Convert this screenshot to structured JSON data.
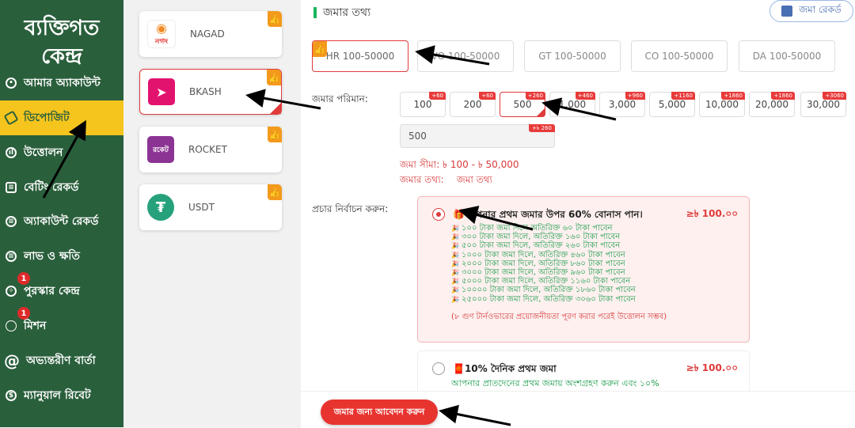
{
  "sidebar": {
    "title_line1": "ব্যক্তিগত",
    "title_line2": "কেন্দ্র",
    "items": [
      {
        "label": "আমার অ্যাকাউন্ট",
        "icon": "account-icon"
      },
      {
        "label": "ডিপোজিট",
        "icon": "deposit-icon",
        "active": true
      },
      {
        "label": "উত্তোলন",
        "icon": "withdraw-icon"
      },
      {
        "label": "বেটিং রেকর্ড",
        "icon": "betting-record-icon"
      },
      {
        "label": "অ্যাকাউন্ট রেকর্ড",
        "icon": "account-record-icon"
      },
      {
        "label": "লাভ ও ক্ষতি",
        "icon": "profit-loss-icon"
      },
      {
        "label": "পুরস্কার কেন্দ্র",
        "icon": "reward-icon",
        "badge": "1"
      },
      {
        "label": "মিশন",
        "icon": "mission-icon",
        "badge": "1"
      },
      {
        "label": "অভ্যন্তরীণ বার্তা",
        "icon": "at-icon"
      },
      {
        "label": "ম্যানুয়াল রিবেট",
        "icon": "rebate-icon"
      }
    ]
  },
  "payments": [
    {
      "name": "NAGAD",
      "logo_text": "নগদ",
      "color": "#ffffff"
    },
    {
      "name": "BKASH",
      "logo_text": "",
      "color": "#e2136e",
      "selected": true
    },
    {
      "name": "ROCKET",
      "logo_text": "রকেট",
      "color": "#8c3494"
    },
    {
      "name": "USDT",
      "logo_text": "₮",
      "color": "#26a17b"
    }
  ],
  "main": {
    "section_title": "জমার তথ্য",
    "record_button": "জমা রেকর্ড",
    "channels": [
      "HR 100-50000",
      "VO 100-50000",
      "GT 100-50000",
      "CO 100-50000",
      "DA 100-50000"
    ],
    "amount_label": "জমার পরিমান:",
    "amounts": [
      {
        "value": "100",
        "bonus": "+60"
      },
      {
        "value": "200",
        "bonus": "+60"
      },
      {
        "value": "500",
        "bonus": "+260",
        "selected": true
      },
      {
        "value": "1,000",
        "bonus": "+460"
      },
      {
        "value": "3,000",
        "bonus": "+960"
      },
      {
        "value": "5,000",
        "bonus": "+1160"
      },
      {
        "value": "10,000",
        "bonus": "+1860"
      },
      {
        "value": "20,000",
        "bonus": "+1860"
      },
      {
        "value": "30,000",
        "bonus": "+3060"
      }
    ],
    "amount_input_value": "500",
    "amount_input_bonus": "+৳ 260",
    "limit_text": "জমা সীমা:  ৳ 100 - ৳ 50,000",
    "info_label": "জমার তথ্য:",
    "info_value": "জমা তথ্য",
    "promo_label": "প্রচার নির্বাচন করুন:",
    "promo1": {
      "title": "🎁আপনার প্রথম জমার উপর 60% বোনাস পান।",
      "amount": "≥৳  100.০০",
      "lines": [
        "১০০ টাকা জমা দিলে অতিরিক্ত ৬০ টাকা পাবেন",
        "৩০০ টাকা জমা দিলে, অতিরিক্ত ১৬০ টাকা পাবেন",
        "৫০০ টাকা জমা দিলে, অতিরিক্ত ২৬০ টাকা পাবেন",
        "১০০০ টাকা জমা দিলে, অতিরিক্ত ৪৬০ টাকা পাবেন",
        "২০০০ টাকা জমা দিলে, অতিরিক্ত ৮৬০ টাকা পাবেন",
        "৩০০০ টাকা জমা দিলে, অতিরিক্ত ৯৬০ টাকা পাবেন",
        "৫০০০ টাকা জমা দিলে, অতিরিক্ত ১১৬০ টাকা পাবেন",
        "১০০০০ টাকা জমা দিলে, অতিরিক্ত ১৮৬০ টাকা পাবেন",
        "২৫০০০ টাকা জমা দিলে, অতিরিক্ত ৩০৬০ টাকা পাবেন"
      ],
      "note": "(৮ গুণ টার্নওভারের প্রয়োজনীয়তা পূরণ করার পরেই উত্তোলন সম্ভব)"
    },
    "promo2": {
      "title": "🧧10% দৈনিক প্রথম জমা",
      "amount": "≥৳  100.০০",
      "desc": "আপনার প্রাতদেনের প্রথম জমায় অংশগ্রহণ করুন এবং ১০%"
    },
    "submit_label": "জমার জন্য আবেদন করুন"
  },
  "colors": {
    "sidebar_bg": "#2a5f3c",
    "active_bg": "#f5c51e",
    "accent_red": "#e03b3b",
    "bonus_green": "#1a9c4b"
  }
}
